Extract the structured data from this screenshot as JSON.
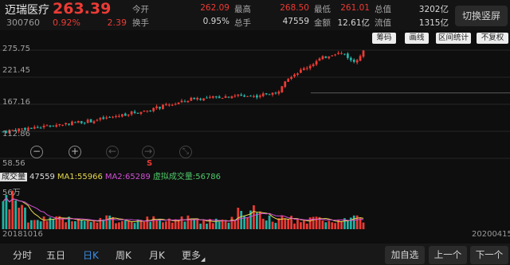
{
  "header": {
    "name": "迈瑞医疗",
    "price": "263.39",
    "code": "300760",
    "change_pct": "0.92%",
    "change": "2.39",
    "stats": [
      {
        "label": "今开",
        "value": "262.09",
        "color": "#ec3b35"
      },
      {
        "label": "最高",
        "value": "268.50",
        "color": "#ec3b35"
      },
      {
        "label": "最低",
        "value": "261.01",
        "color": "#ec3b35"
      },
      {
        "label": "总值",
        "value": "3202亿",
        "color": "#d8d8d8"
      },
      {
        "label": "换手",
        "value": "0.95%",
        "color": "#d8d8d8"
      },
      {
        "label": "总手",
        "value": "47559",
        "color": "#d8d8d8"
      },
      {
        "label": "金额",
        "value": "12.61亿",
        "color": "#d8d8d8"
      },
      {
        "label": "流值",
        "value": "1315亿",
        "color": "#d8d8d8"
      }
    ],
    "switch_label": "切换竖屏"
  },
  "toolbar": {
    "buttons": [
      "筹码",
      "画线",
      "区间统计",
      "不复权"
    ]
  },
  "axis": {
    "y_ticks": [
      "275.75",
      "221.45",
      "167.16",
      "112.86",
      "58.56"
    ],
    "vol_max": "56万"
  },
  "indicators": {
    "label": "成交量",
    "vol": "47559",
    "ma1": "MA1:55966",
    "ma2": "MA2:65289",
    "virtual": "虚拟成交量:56786"
  },
  "marker": "S",
  "dates": {
    "start": "20181016",
    "end": "20200415"
  },
  "bottom": {
    "tabs": [
      "分时",
      "五日",
      "日K",
      "周K",
      "月K",
      "更多"
    ],
    "active_tab": "日K",
    "buttons": [
      "加自选",
      "上一个",
      "下一个"
    ]
  },
  "colors": {
    "up": "#ec3b35",
    "down": "#22b3a6",
    "accent": "#3a8ee6"
  },
  "chart_data": {
    "type": "candlestick",
    "x_range": [
      "20181016",
      "20200415"
    ],
    "ylim": [
      58.56,
      275.75
    ],
    "close_trend": [
      [
        0,
        112
      ],
      [
        0.05,
        118
      ],
      [
        0.1,
        121
      ],
      [
        0.15,
        126
      ],
      [
        0.2,
        131
      ],
      [
        0.25,
        134
      ],
      [
        0.3,
        141
      ],
      [
        0.35,
        149
      ],
      [
        0.4,
        155
      ],
      [
        0.45,
        164
      ],
      [
        0.5,
        172
      ],
      [
        0.53,
        180
      ],
      [
        0.56,
        178
      ],
      [
        0.6,
        182
      ],
      [
        0.65,
        185
      ],
      [
        0.7,
        183
      ],
      [
        0.74,
        190
      ],
      [
        0.76,
        188
      ],
      [
        0.78,
        215
      ],
      [
        0.8,
        225
      ],
      [
        0.84,
        240
      ],
      [
        0.88,
        258
      ],
      [
        0.92,
        270
      ],
      [
        0.95,
        268
      ],
      [
        0.97,
        250
      ],
      [
        1.0,
        272
      ]
    ],
    "volume_ylim": [
      0,
      560000
    ]
  }
}
